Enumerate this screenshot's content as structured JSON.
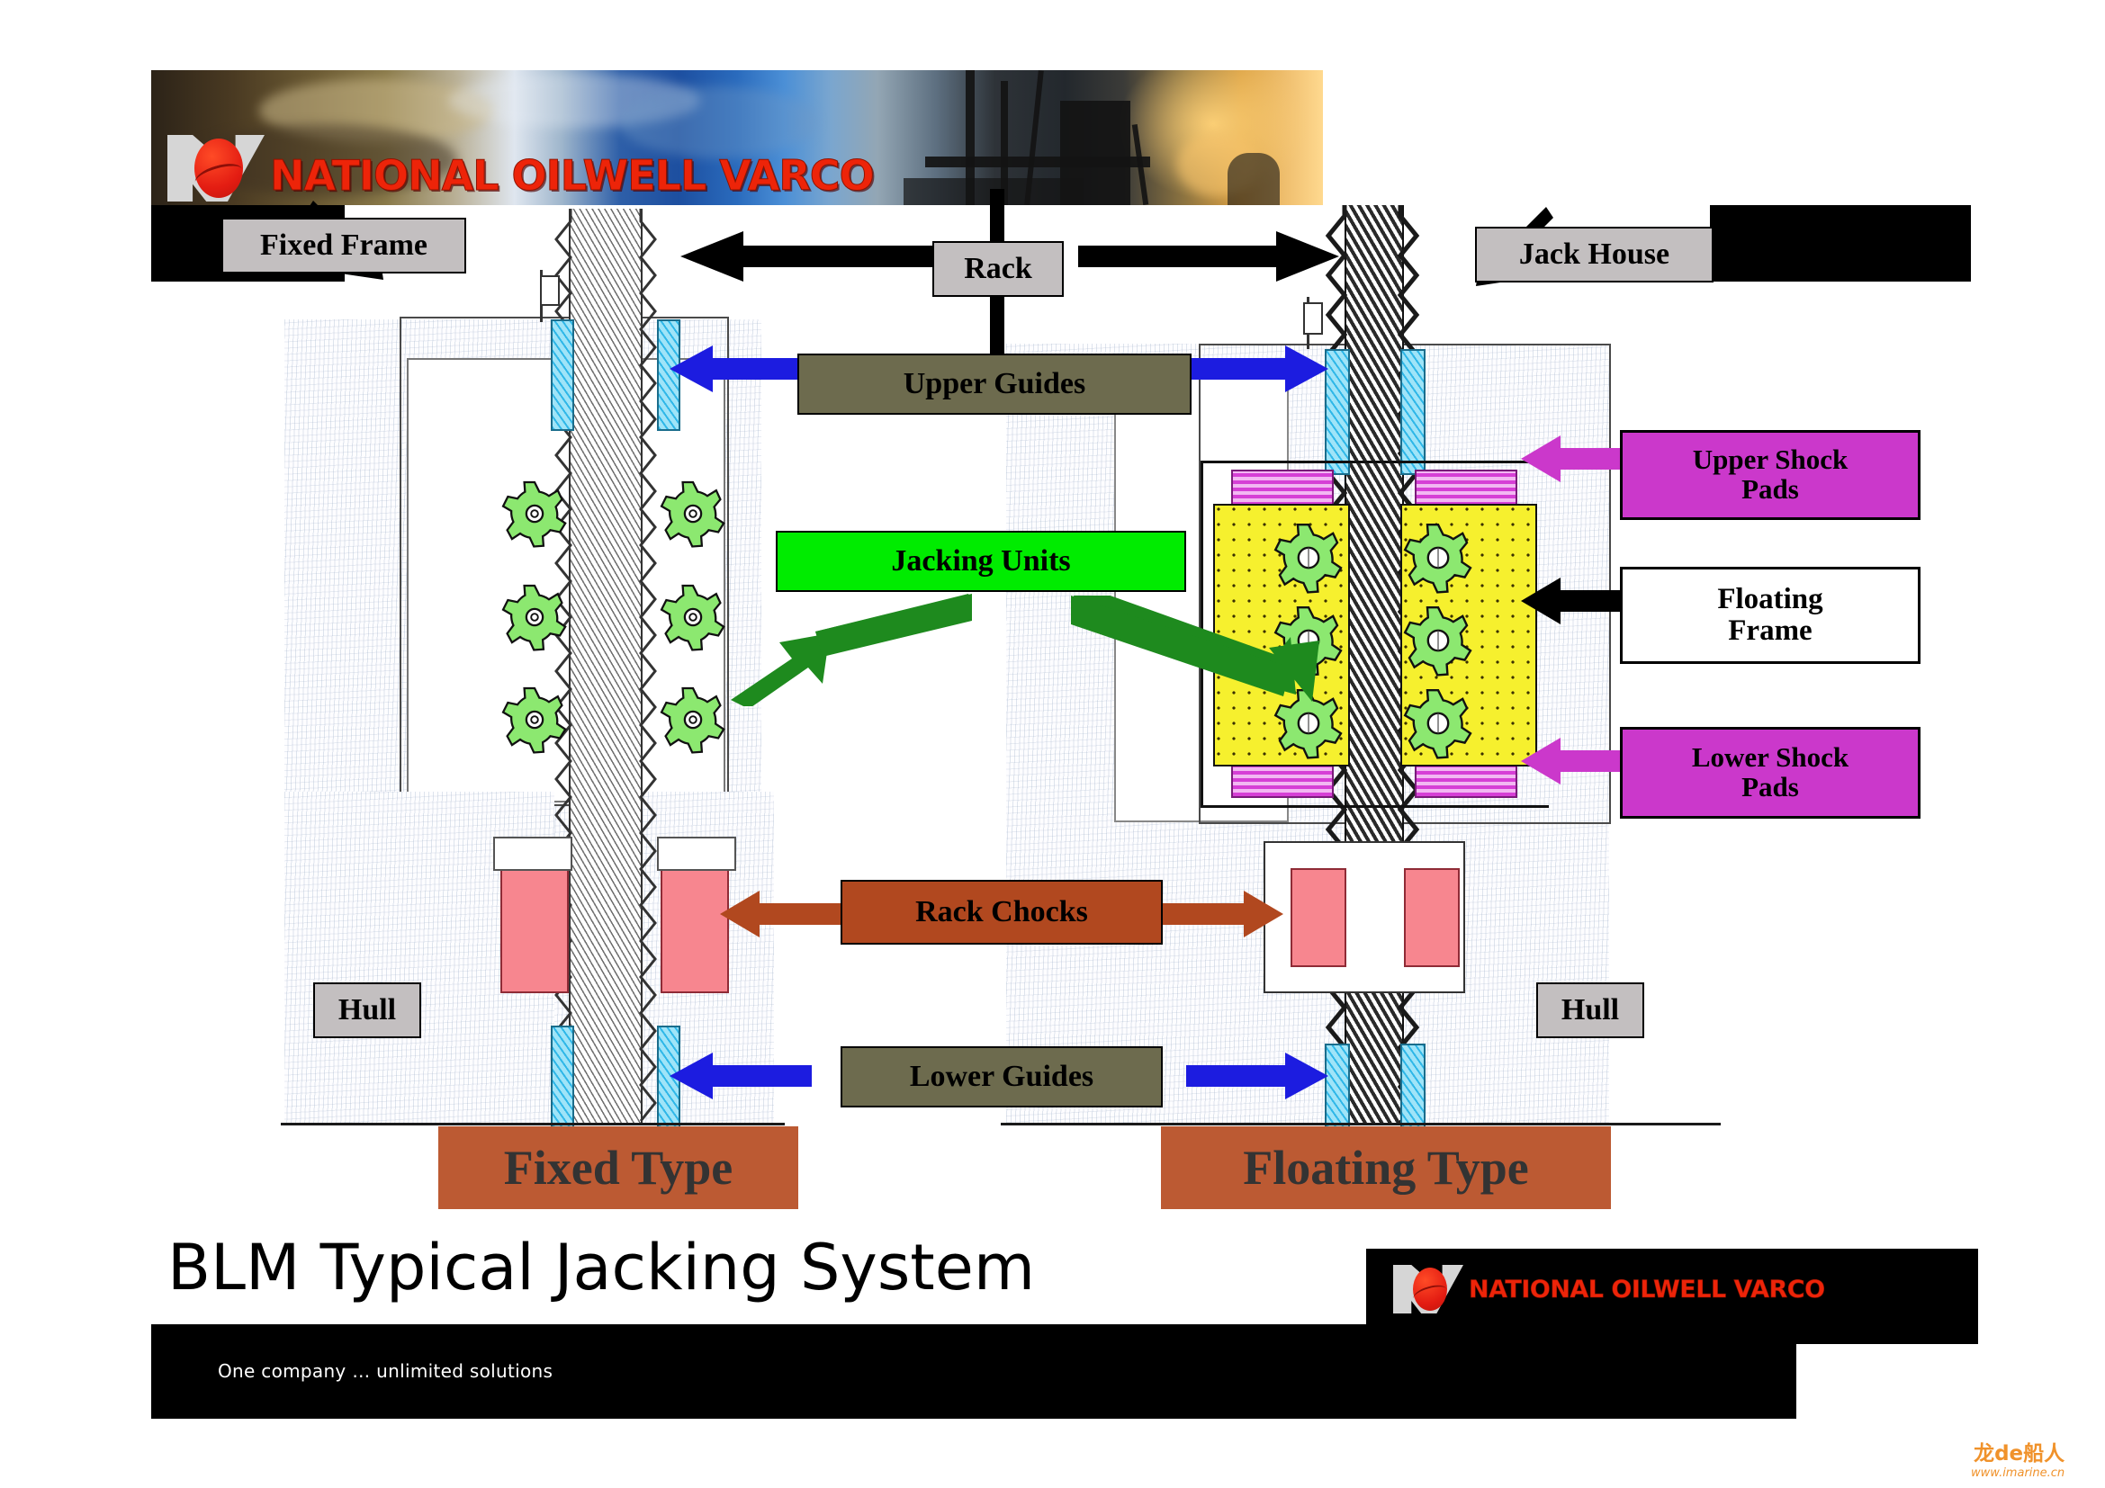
{
  "brand": {
    "logo_icon": "nov-globe-logo",
    "wordmark": "NATIONAL OILWELL VARCO",
    "tagline": "One company …  unlimited solutions"
  },
  "page_title": "BLM Typical Jacking System",
  "labels": {
    "fixed_frame": "Fixed Frame",
    "rack": "Rack",
    "jack_house": "Jack House",
    "upper_guides": "Upper Guides",
    "upper_shock_pads": "Upper Shock\nPads",
    "upper_shock_pads_line1": "Upper Shock",
    "upper_shock_pads_line2": "Pads",
    "jacking_units": "Jacking Units",
    "floating_frame_line1": "Floating",
    "floating_frame_line2": "Frame",
    "lower_shock_pads_line1": "Lower Shock",
    "lower_shock_pads_line2": "Pads",
    "rack_chocks": "Rack Chocks",
    "hull_left": "Hull",
    "hull_right": "Hull",
    "lower_guides": "Lower Guides",
    "fixed_type": "Fixed Type",
    "floating_type": "Floating Type"
  },
  "colors": {
    "grey_label": "#c3bfc0",
    "olive_label": "#6d6b4e",
    "green_label": "#00ec00",
    "magenta_label": "#cb38cb",
    "brown_title": "#bc5a33",
    "brand_red": "#ed2409",
    "gear_green": "#8ce870",
    "guide_cyan": "#2fb7e8",
    "chock_pink": "#f7868f",
    "shock_pad_magenta": "#d63fd6",
    "floating_frame_yellow": "#f6f02e",
    "blue_arrow": "#1c1ce0",
    "green_arrow": "#1e8a1e",
    "brown_arrow": "#b1481f"
  },
  "watermark": {
    "name": "龙de船人",
    "url": "www.imarine.cn"
  }
}
